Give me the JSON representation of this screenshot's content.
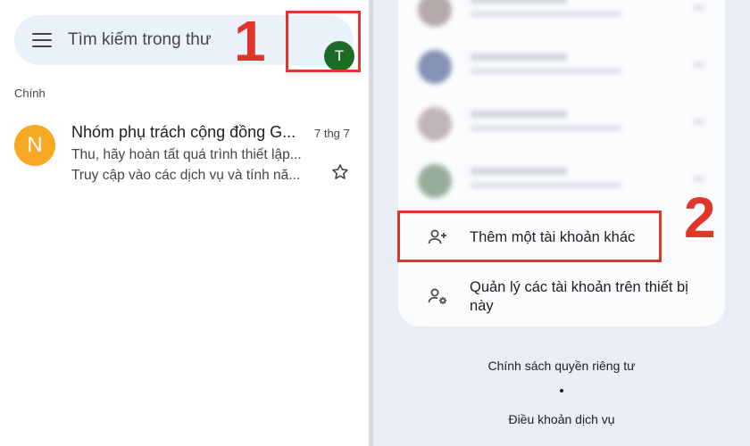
{
  "search": {
    "placeholder": "Tìm kiếm trong thư"
  },
  "account": {
    "avatar_letter": "T",
    "avatar_color": "#1e6b26"
  },
  "annotations": {
    "step1": "1",
    "step2": "2",
    "highlight_color": "#e0352b"
  },
  "inbox": {
    "section_label": "Chính",
    "emails": [
      {
        "avatar_letter": "N",
        "avatar_color": "#f8a823",
        "sender": "Nhóm phụ trách cộng đồng G...",
        "date": "7 thg 7",
        "subject": "Thu, hãy hoàn tất quá trình thiết lập...",
        "snippet": "Truy cập vào các dịch vụ và tính nă...",
        "star_icon": "star-outline-icon"
      }
    ]
  },
  "account_panel": {
    "add_account": {
      "label": "Thêm một tài khoản khác",
      "icon": "add-person-icon"
    },
    "manage_accounts": {
      "label": "Quản lý các tài khoản trên thiết bị này",
      "icon": "manage-accounts-icon"
    }
  },
  "footer": {
    "privacy": "Chính sách quyền riêng tư",
    "terms": "Điều khoản dịch vụ"
  }
}
